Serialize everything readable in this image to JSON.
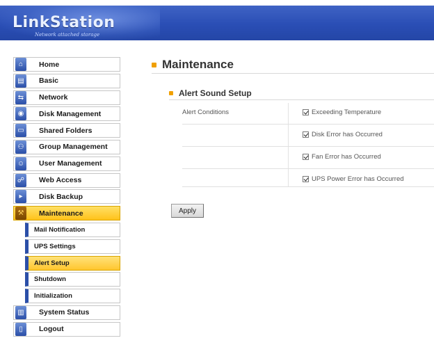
{
  "header": {
    "logo": "LinkStation",
    "tagline": "Network attached storage"
  },
  "sidebar": {
    "items": [
      {
        "label": "Home",
        "icon": "home-icon",
        "glyph": "⌂"
      },
      {
        "label": "Basic",
        "icon": "basic-icon",
        "glyph": "▤"
      },
      {
        "label": "Network",
        "icon": "network-icon",
        "glyph": "⇆"
      },
      {
        "label": "Disk Management",
        "icon": "disk-icon",
        "glyph": "◉"
      },
      {
        "label": "Shared Folders",
        "icon": "folder-icon",
        "glyph": "▭"
      },
      {
        "label": "Group Management",
        "icon": "group-icon",
        "glyph": "⚇"
      },
      {
        "label": "User Management",
        "icon": "user-icon",
        "glyph": "☺"
      },
      {
        "label": "Web Access",
        "icon": "web-icon",
        "glyph": "☍"
      },
      {
        "label": "Disk Backup",
        "icon": "backup-icon",
        "glyph": "▸"
      },
      {
        "label": "Maintenance",
        "icon": "maintenance-icon",
        "glyph": "⚒"
      }
    ],
    "subitems": [
      {
        "label": "Mail Notification"
      },
      {
        "label": "UPS Settings"
      },
      {
        "label": "Alert Setup"
      },
      {
        "label": "Shutdown"
      },
      {
        "label": "Initialization"
      }
    ],
    "bottom": [
      {
        "label": "System Status",
        "icon": "status-icon",
        "glyph": "▥"
      },
      {
        "label": "Logout",
        "icon": "logout-icon",
        "glyph": "▯"
      }
    ]
  },
  "main": {
    "title": "Maintenance",
    "section_title": "Alert Sound Setup",
    "conditions_label": "Alert Conditions",
    "conditions": [
      {
        "label": "Exceeding Temperature",
        "checked": true
      },
      {
        "label": "Disk Error has Occurred",
        "checked": true
      },
      {
        "label": "Fan Error has Occurred",
        "checked": true
      },
      {
        "label": "UPS Power Error has Occurred",
        "checked": true
      }
    ],
    "apply_label": "Apply"
  },
  "colors": {
    "header_blue": "#2a4eb5",
    "active_yellow": "#ffc21a",
    "bullet_orange": "#f0a000"
  }
}
